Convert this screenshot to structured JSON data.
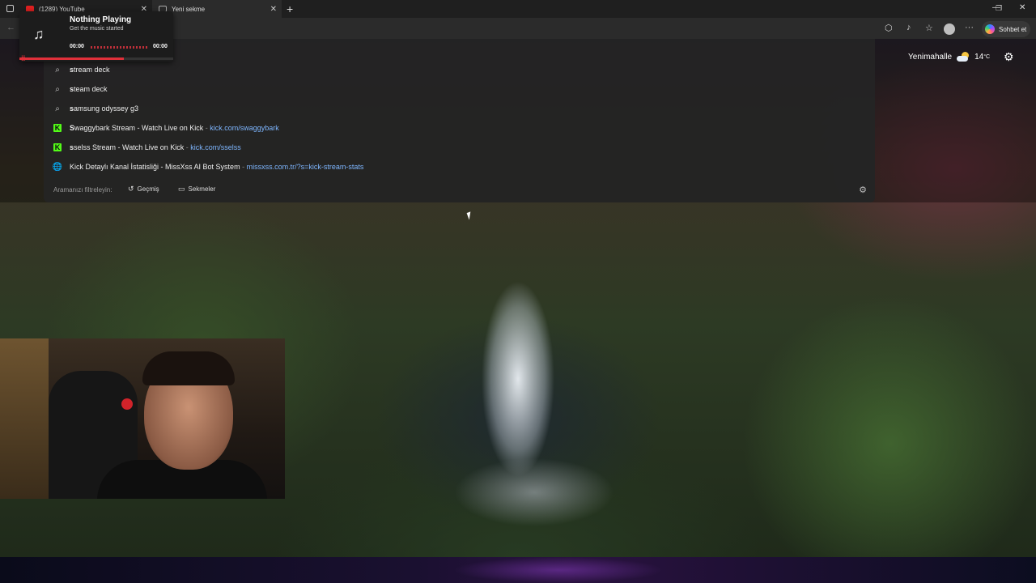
{
  "tabs": [
    {
      "label": "(1289) YouTube",
      "icon": "youtube-icon",
      "color": "#e02020"
    },
    {
      "label": "Yeni sekme",
      "icon": "new-tab-icon",
      "color": "#9a9a9a"
    }
  ],
  "media_player": {
    "title": "Nothing Playing",
    "subtitle": "Get the music started",
    "time_start": "00:00",
    "time_end": "00:00",
    "progress_fraction": 0.68
  },
  "suggestions": [
    {
      "type": "search",
      "bold": "s",
      "rest": "tream deck",
      "url": ""
    },
    {
      "type": "search",
      "bold": "s",
      "rest": "team deck",
      "url": ""
    },
    {
      "type": "search",
      "bold": "s",
      "rest": "amsung odyssey g3",
      "url": ""
    },
    {
      "type": "kick",
      "bold": "S",
      "rest": "waggybark Stream - Watch Live on Kick",
      "sep": " - ",
      "url": "kick.com/swaggybark"
    },
    {
      "type": "kick",
      "bold": "s",
      "rest": "selss Stream - Watch Live on Kick",
      "sep": " - ",
      "url": "kick.com/sselss"
    },
    {
      "type": "web",
      "bold": "",
      "rest": "Kick Detaylı Kanal İstatisliği - MissXss AI Bot System",
      "sep": " - ",
      "url": "missxss.com.tr/?s=kick-stream-stats"
    }
  ],
  "filter": {
    "label": "Aramanızı filtreleyin:",
    "history": "Geçmiş",
    "tabs": "Sekmeler"
  },
  "weather": {
    "location": "Yenimahalle",
    "temp": "14",
    "unit": "°C"
  },
  "copilot": {
    "label": "Sohbet et"
  },
  "colors": {
    "kick_green": "#53fc18",
    "url_blue": "#7eb6ff",
    "accent_red": "#e0303a"
  }
}
